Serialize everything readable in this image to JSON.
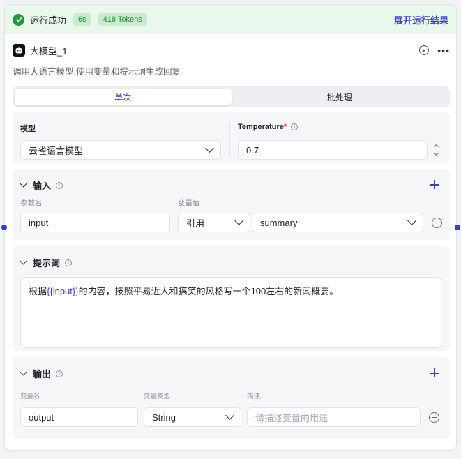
{
  "run_status": {
    "label": "运行成功",
    "duration": "6s",
    "tokens": "418 Tokens",
    "expand_label": "展开运行结果",
    "colors": {
      "success": "#1f9d3a",
      "accent": "#3c3ec4"
    }
  },
  "node": {
    "title": "大模型_1",
    "description": "调用大语言模型,使用变量和提示词生成回复",
    "icon": "robot-icon"
  },
  "mode_tabs": [
    {
      "label": "单次",
      "active": true
    },
    {
      "label": "批处理",
      "active": false
    }
  ],
  "model_section": {
    "model_label": "模型",
    "model_value": "云雀语言模型",
    "temperature_label": "Temperature",
    "temperature_required_mark": "*",
    "temperature_value": "0.7"
  },
  "input_section": {
    "title": "输入",
    "col_name": "参数名",
    "col_value": "变量值",
    "rows": [
      {
        "name": "input",
        "ref_type": "引用",
        "ref_value": "summary"
      }
    ]
  },
  "prompt_section": {
    "title": "提示词",
    "text_before": "根据",
    "variable": "{{input}}",
    "text_after": "的内容，按照平易近人和搞笑的风格写一个100左右的新闻概要。"
  },
  "output_section": {
    "title": "输出",
    "col_name": "变量名",
    "col_type": "变量类型",
    "col_desc": "描述",
    "rows": [
      {
        "name": "output",
        "type": "String",
        "desc_placeholder": "请描述变量的用途"
      }
    ]
  }
}
